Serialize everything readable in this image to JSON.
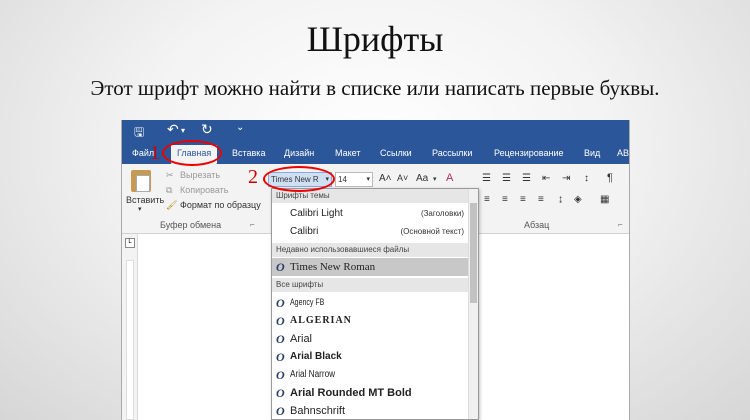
{
  "slide": {
    "title": "Шрифты",
    "subtitle": "Этот шрифт можно найти в списке или написать первые буквы."
  },
  "word": {
    "qat": {
      "save_glyph": "🖫",
      "undo_glyph": "↶",
      "undo_arrow": "▾",
      "redo_glyph": "↻",
      "more_glyph": "⌄"
    },
    "tabs": [
      "Файл",
      "Главная",
      "Вставка",
      "Дизайн",
      "Макет",
      "Ссылки",
      "Рассылки",
      "Рецензирование",
      "Вид",
      "AB"
    ],
    "active_tab": "Главная",
    "clipboard": {
      "paste_label": "Вставить",
      "paste_arrow": "▾",
      "cut": "Вырезать",
      "copy": "Копировать",
      "format_painter": "Формат по образцу",
      "group": "Буфер обмена",
      "launcher": "⌐"
    },
    "font": {
      "name_value": "Times New R",
      "name_arrow": "▾",
      "size_value": "14",
      "size_arrow": "▾",
      "grow": "A˄",
      "shrink": "A˅",
      "case": "Aa",
      "case_arrow": "▾",
      "clear": "A"
    },
    "paragraph": {
      "group": "Абзац",
      "pilcrow": "¶",
      "launcher": "⌐"
    },
    "ruler_corner": "L",
    "dropdown": {
      "theme_header": "Шрифты темы",
      "theme_fonts": [
        {
          "name": "Calibri Light",
          "tag": "(Заголовки)"
        },
        {
          "name": "Calibri",
          "tag": "(Основной текст)"
        }
      ],
      "recent_header": "Недавно использовавшиеся файлы",
      "recent_font": "Times New Roman",
      "all_header": "Все шрифты",
      "all_fonts": [
        "Agency FB",
        "ALGERIAN",
        "Arial",
        "Arial Black",
        "Arial Narrow",
        "Arial Rounded MT Bold",
        "Bahnschrift"
      ],
      "font_icon": "O"
    }
  },
  "annotations": {
    "step1": "1",
    "step2": "2"
  },
  "colors": {
    "word_blue": "#2b579a",
    "annotation_red": "#e00000"
  }
}
